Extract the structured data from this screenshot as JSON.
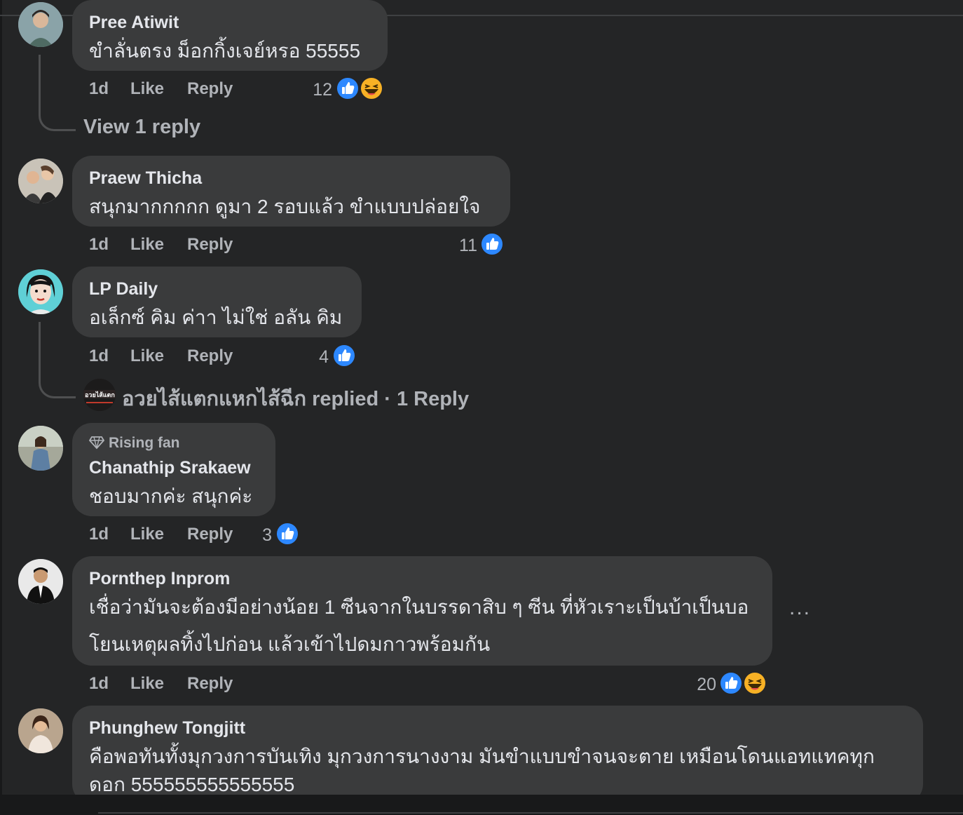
{
  "colors": {
    "like_blue": "#2d88ff",
    "bubble": "#3a3b3c",
    "background": "#242526",
    "muted": "#b0b3b8"
  },
  "comments": [
    {
      "author": "Pree Atiwit",
      "text": "ขำลั่นตรง ม็อกกิ้งเจย์หรอ 55555",
      "time": "1d",
      "like": "Like",
      "reply": "Reply",
      "reaction_count": "12",
      "reactions": [
        "like-icon",
        "haha-icon"
      ]
    },
    {
      "author": "Praew Thicha",
      "text": "สนุกมากกกกก ดูมา 2 รอบแล้ว ขำแบบปล่อยใจ",
      "time": "1d",
      "like": "Like",
      "reply": "Reply",
      "reaction_count": "11",
      "reactions": [
        "like-icon"
      ]
    },
    {
      "author": "LP Daily",
      "text": "อเล็กซ์ คิม ค่าา ไม่ใช่ อลัน คิม",
      "time": "1d",
      "like": "Like",
      "reply": "Reply",
      "reaction_count": "4",
      "reactions": [
        "like-icon"
      ]
    },
    {
      "badge": "Rising fan",
      "author": "Chanathip Srakaew",
      "text": "ชอบมากค่ะ สนุกค่ะ",
      "time": "1d",
      "like": "Like",
      "reply": "Reply",
      "reaction_count": "3",
      "reactions": [
        "like-icon"
      ]
    },
    {
      "author": "Pornthep Inprom",
      "text_line1": "เชื่อว่ามันจะต้องมีอย่างน้อย 1 ซีนจากในบรรดาสิบ ๆ ซีน ที่หัวเราะเป็นบ้าเป็นบอ",
      "text_line2": "โยนเหตุผลทิ้งไปก่อน แล้วเข้าไปดมกาวพร้อมกัน",
      "time": "1d",
      "like": "Like",
      "reply": "Reply",
      "reaction_count": "20",
      "reactions": [
        "like-icon",
        "haha-icon"
      ],
      "more": "..."
    },
    {
      "author": "Phunghew Tongjitt",
      "text_line1": "คือพอทันทั้งมุกวงการบันเทิง มุกวงการนางงาม มันขำแบบขำจนจะตาย เหมือนโดนแอทแทคทุก",
      "text_line2": "ดอก 555555555555555"
    }
  ],
  "view_reply_1": "View 1 reply",
  "replied_summary": "อวยไส้แตกแหกไส้ฉีก replied · 1 Reply",
  "replier_avatar_text": "อวยไส้แตก"
}
